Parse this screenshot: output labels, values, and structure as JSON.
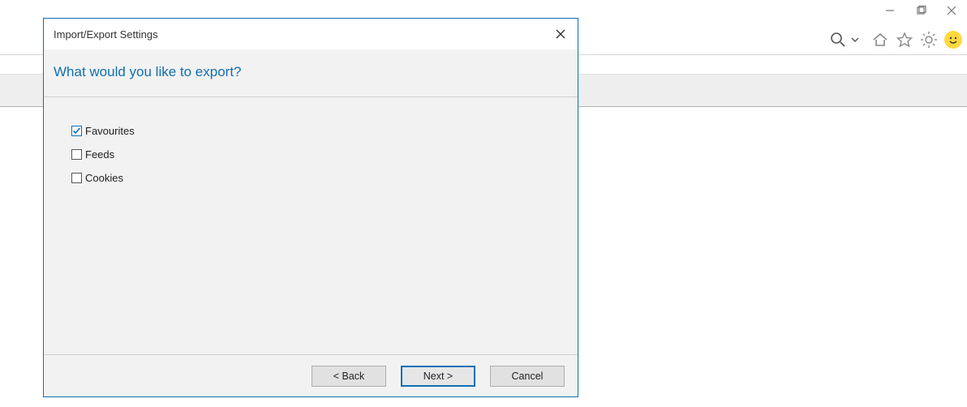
{
  "window_controls": {
    "minimize": "minimize-icon",
    "maximize": "maximize-icon",
    "close": "close-icon"
  },
  "toolbar": {
    "search_icon": "search-icon",
    "dropdown_icon": "chevron-down-icon",
    "home_icon": "home-icon",
    "favorites_icon": "star-icon",
    "settings_icon": "gear-icon",
    "smiley_icon": "smiley-icon"
  },
  "dialog": {
    "title": "Import/Export Settings",
    "heading": "What would you like to export?",
    "options": [
      {
        "label": "Favourites",
        "checked": true
      },
      {
        "label": "Feeds",
        "checked": false
      },
      {
        "label": "Cookies",
        "checked": false
      }
    ],
    "buttons": {
      "back": "< Back",
      "next": "Next >",
      "cancel": "Cancel"
    }
  }
}
